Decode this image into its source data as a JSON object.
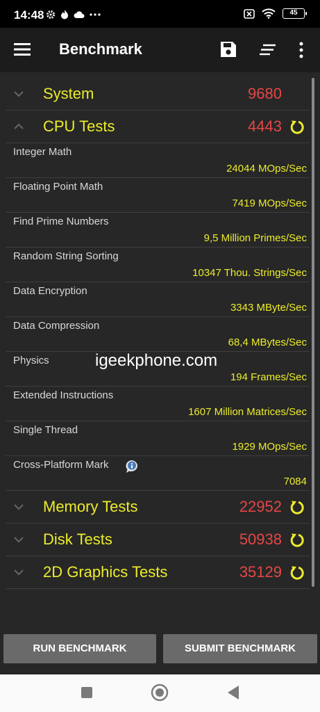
{
  "status": {
    "time": "14:48",
    "battery": "45"
  },
  "app": {
    "title": "Benchmark"
  },
  "groups": {
    "system": {
      "name": "System",
      "score": "9680"
    },
    "cpu": {
      "name": "CPU Tests",
      "score": "4443"
    },
    "memory": {
      "name": "Memory Tests",
      "score": "22952"
    },
    "disk": {
      "name": "Disk Tests",
      "score": "50938"
    },
    "graphics2d": {
      "name": "2D Graphics Tests",
      "score": "35129"
    }
  },
  "tests": [
    {
      "name": "Integer Math",
      "value": "24044 MOps/Sec"
    },
    {
      "name": "Floating Point Math",
      "value": "7419 MOps/Sec"
    },
    {
      "name": "Find Prime Numbers",
      "value": "9,5 Million Primes/Sec"
    },
    {
      "name": "Random String Sorting",
      "value": "10347 Thou. Strings/Sec"
    },
    {
      "name": "Data Encryption",
      "value": "3343 MByte/Sec"
    },
    {
      "name": "Data Compression",
      "value": "68,4 MBytes/Sec"
    },
    {
      "name": "Physics",
      "value": "194 Frames/Sec"
    },
    {
      "name": "Extended Instructions",
      "value": "1607 Million Matrices/Sec"
    },
    {
      "name": "Single Thread",
      "value": "1929 MOps/Sec"
    },
    {
      "name": "Cross-Platform Mark",
      "value": "7084"
    }
  ],
  "watermark": "igeekphone.com",
  "buttons": {
    "run": "RUN BENCHMARK",
    "submit": "SUBMIT BENCHMARK"
  },
  "colors": {
    "accent_yellow": "#ecec2c",
    "score_red": "#e64646",
    "background": "#272727",
    "appbar": "#1c1c1c",
    "button": "#6a6a6a"
  },
  "icons": [
    "menu-icon",
    "save-icon",
    "sort-icon",
    "more-icon",
    "chevron-down-icon",
    "chevron-up-icon",
    "refresh-icon",
    "info-icon"
  ]
}
